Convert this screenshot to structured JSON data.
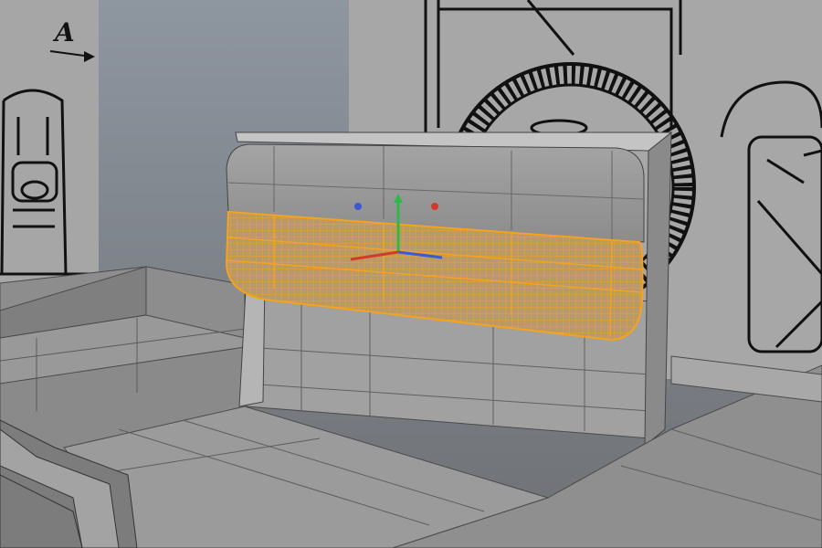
{
  "viewport": {
    "blueprint_label": "A",
    "selection_color": "#f5a21e",
    "axis_colors": {
      "x": "#d23a2a",
      "y": "#2fb84a",
      "z": "#3a5ad8"
    },
    "background_color": "#8d9299",
    "model_color": "#9a9a9a",
    "icons": [
      "move-gizmo-icon"
    ]
  }
}
